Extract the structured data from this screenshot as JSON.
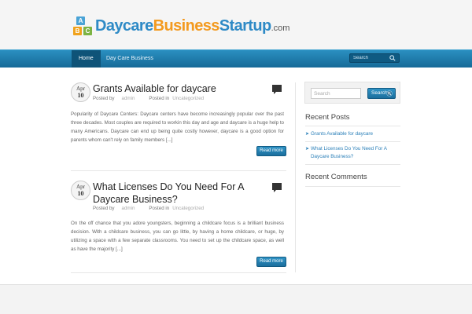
{
  "header": {
    "logo": {
      "blocks": [
        "A",
        "B",
        "C"
      ],
      "word1": "Daycare",
      "word2": "Business",
      "word3": "Startup",
      "suffix": ".com"
    }
  },
  "nav": {
    "items": [
      {
        "label": "Home",
        "active": true
      },
      {
        "label": "Day Care Business",
        "active": false
      }
    ],
    "search_placeholder": "Search"
  },
  "posts": [
    {
      "date_month": "Apr",
      "date_day": "10",
      "title": "Grants Available for daycare",
      "posted_by_label": "Posted by",
      "author": "admin",
      "posted_in_label": "Posted in",
      "category": "Uncategorized",
      "excerpt": "Popularity of Daycare Centers: Daycare centers have become increasingly popular over the past three decades. Most couples are required to workin this day and age and daycare is a huge help to many Americans. Daycare can end up being quite costly however, daycare is a good option for parents whom can't rely on family members [...]",
      "read_more": "Read more"
    },
    {
      "date_month": "Apr",
      "date_day": "10",
      "title": "What Licenses Do You Need For A Daycare Business?",
      "posted_by_label": "Posted by",
      "author": "admin",
      "posted_in_label": "Posted in",
      "category": "Uncategorized",
      "excerpt": "On the off chance that you adore youngsters, beginning a childcare focus is a brilliant business decision. With a childcare business, you can go little, by having a home childcare, or huge, by utilizing a space with a few separate classrooms. You need to set up the childcare space, as well as have the majority [...]",
      "read_more": "Read more"
    }
  ],
  "sidebar": {
    "search_placeholder": "Search",
    "search_button": "Search",
    "recent_posts_title": "Recent Posts",
    "recent_posts": [
      "Grants Available for daycare",
      "What Licenses Do You Need For A Daycare Business?"
    ],
    "recent_comments_title": "Recent Comments"
  },
  "colors": {
    "nav_blue": "#1f7eb0",
    "link_blue": "#2a7fb8",
    "logo_orange": "#f39a1f"
  },
  "icons": [
    "search-icon",
    "comment-icon",
    "arrow-icon"
  ]
}
